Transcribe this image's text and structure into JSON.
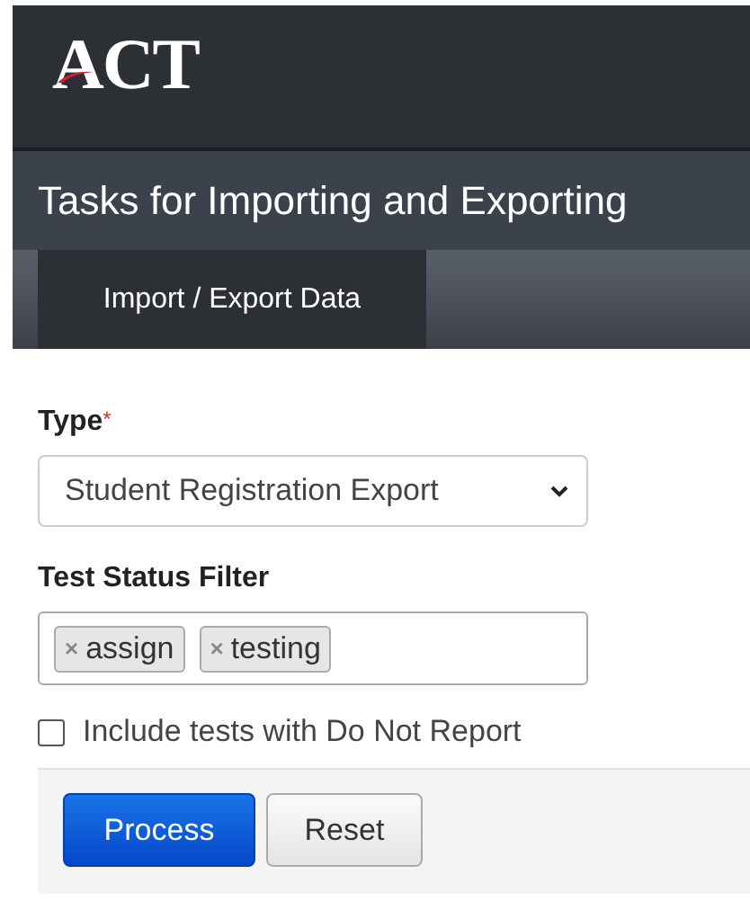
{
  "header": {
    "logo": "ACT"
  },
  "page_title": "Tasks for Importing and Exporting",
  "tabs": [
    {
      "label": "Import / Export Data",
      "selected": true
    }
  ],
  "form": {
    "type_field": {
      "label": "Type",
      "required_mark": "*",
      "value": "Student Registration Export"
    },
    "status_filter": {
      "label": "Test Status Filter",
      "tags": [
        {
          "remove": "×",
          "label": "assign"
        },
        {
          "remove": "×",
          "label": "testing"
        }
      ]
    },
    "checkbox": {
      "label": "Include tests with Do Not Report",
      "checked": false
    }
  },
  "buttons": [
    {
      "label": "Process",
      "kind": "primary"
    },
    {
      "label": "Reset",
      "kind": "secondary"
    }
  ]
}
